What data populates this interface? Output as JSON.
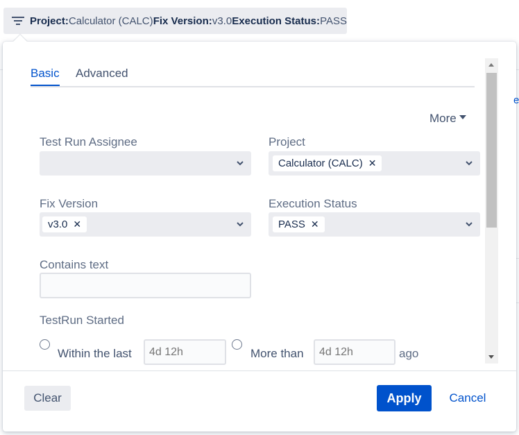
{
  "summary": {
    "project_label": "Project",
    "project_value": "Calculator (CALC)",
    "fix_version_label": "Fix Version",
    "fix_version_value": "v3.0",
    "execution_status_label": "Execution Status",
    "execution_status_value": "PASS",
    "separator": ":"
  },
  "tabs": [
    {
      "label": "Basic",
      "active": true
    },
    {
      "label": "Advanced",
      "active": false
    }
  ],
  "more_label": "More",
  "fields": {
    "test_run_assignee": {
      "label": "Test Run Assignee",
      "value": ""
    },
    "project": {
      "label": "Project",
      "tag": "Calculator (CALC)"
    },
    "fix_version": {
      "label": "Fix Version",
      "tag": "v3.0"
    },
    "execution_status": {
      "label": "Execution Status",
      "tag": "PASS"
    },
    "contains_text": {
      "label": "Contains text",
      "value": ""
    }
  },
  "testrun_started": {
    "label": "TestRun Started",
    "within_label": "Within the last",
    "within_placeholder": "4d 12h",
    "more_than_label": "More than",
    "more_than_placeholder": "4d 12h",
    "ago_label": "ago"
  },
  "remove_glyph": "✕",
  "buttons": {
    "clear": "Clear",
    "apply": "Apply",
    "cancel": "Cancel"
  },
  "colors": {
    "accent": "#0052cc",
    "field_bg": "#ebecf0",
    "text": "#172b4d",
    "label": "#5e6c84"
  },
  "icons": {
    "filter": "filter-icon",
    "chevron": "chevron-down-icon",
    "remove": "close-icon"
  }
}
